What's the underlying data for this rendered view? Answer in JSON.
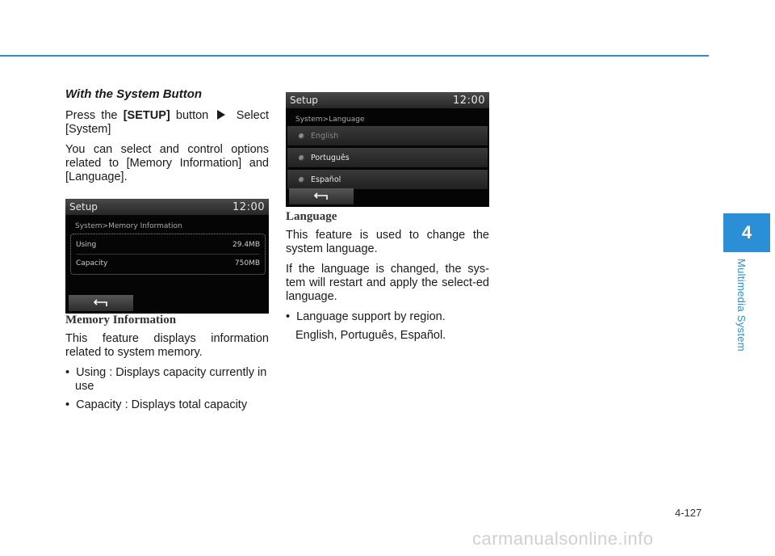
{
  "chapter": {
    "number": "4",
    "title": "Multimedia System"
  },
  "page_number": "4-127",
  "watermark": "carmanualsonline.info",
  "left_column": {
    "heading": "With the System Button",
    "intro_pre": "Press the ",
    "intro_button": "[SETUP]",
    "intro_mid": " button ",
    "intro_post": " Select [System]",
    "paragraph": "You can select and control options related to [Memory Information] and [Language].",
    "screen": {
      "title": "Setup",
      "time": "12:00",
      "path": "System>Memory Information",
      "rows": [
        {
          "label": "Using",
          "value": "29.4MB"
        },
        {
          "label": "Capacity",
          "value": "750MB"
        }
      ],
      "back_icon": "return-arrow"
    },
    "section_heading": "Memory Information",
    "section_text": "This feature displays information related to system memory.",
    "bullets": [
      "Using : Displays capacity currently in use",
      "Capacity : Displays total capacity"
    ]
  },
  "right_column": {
    "screen": {
      "title": "Setup",
      "time": "12:00",
      "path": "System>Language",
      "options": [
        "English",
        "Português",
        "Español"
      ],
      "selected": "English"
    },
    "section_heading": "Language",
    "paragraphs": [
      "This feature is used to change the system language.",
      "If the language is changed, the sys-tem will restart and apply the select-ed language."
    ],
    "bullet": "Language support by region.",
    "bullet_detail": "English, Português, Español."
  },
  "colors": {
    "accent": "#2a8fd6"
  }
}
